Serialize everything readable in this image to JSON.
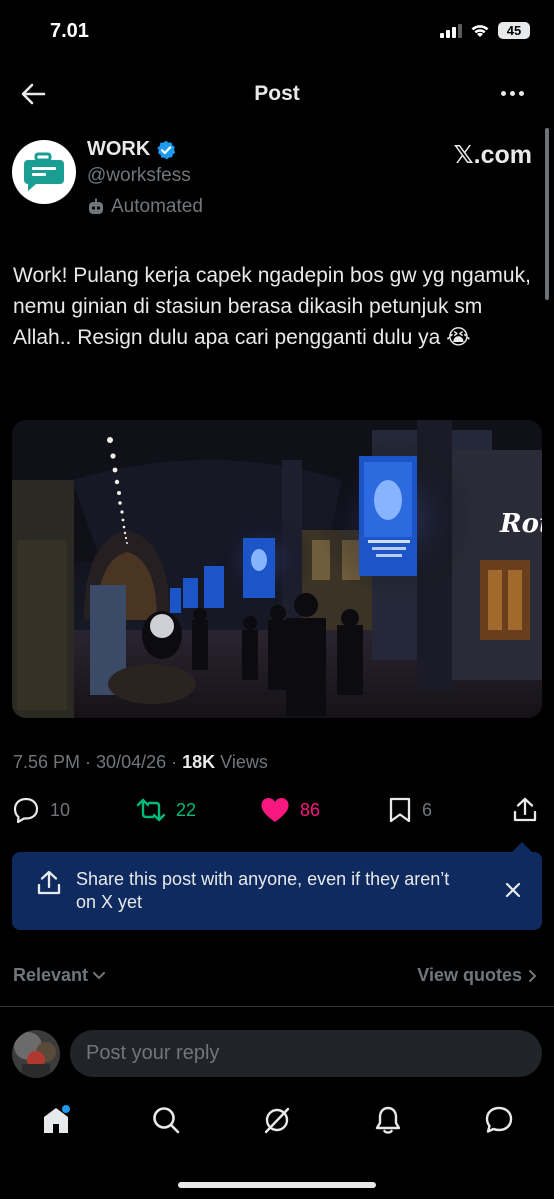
{
  "status_bar": {
    "time": "7.01",
    "battery": "45"
  },
  "header": {
    "title": "Post"
  },
  "author": {
    "name": "WORK",
    "handle": "@worksfess",
    "automated_label": "Automated",
    "source": "𝕏.com"
  },
  "post": {
    "text": "Work! Pulang kerja capek ngadepin bos gw yg ngamuk, nemu ginian di stasiun berasa dikasih petunjuk sm Allah.. Resign dulu apa cari pengganti dulu ya 😭",
    "time": "7.56 PM",
    "date": "30/04/26",
    "views_count": "18K",
    "views_label": "Views",
    "image_sign_text": "Roti"
  },
  "actions": {
    "replies": "10",
    "reposts": "22",
    "likes": "86",
    "bookmarks": "6"
  },
  "share_banner": {
    "text": "Share this post with anyone, even if they aren’t on X yet"
  },
  "replies_filter": {
    "sort": "Relevant",
    "view_quotes": "View quotes"
  },
  "reply": {
    "placeholder": "Post your reply"
  },
  "colors": {
    "accent": "#1d9bf0",
    "repost": "#00ba7c",
    "like": "#f91880",
    "banner": "#0f2a5f"
  }
}
